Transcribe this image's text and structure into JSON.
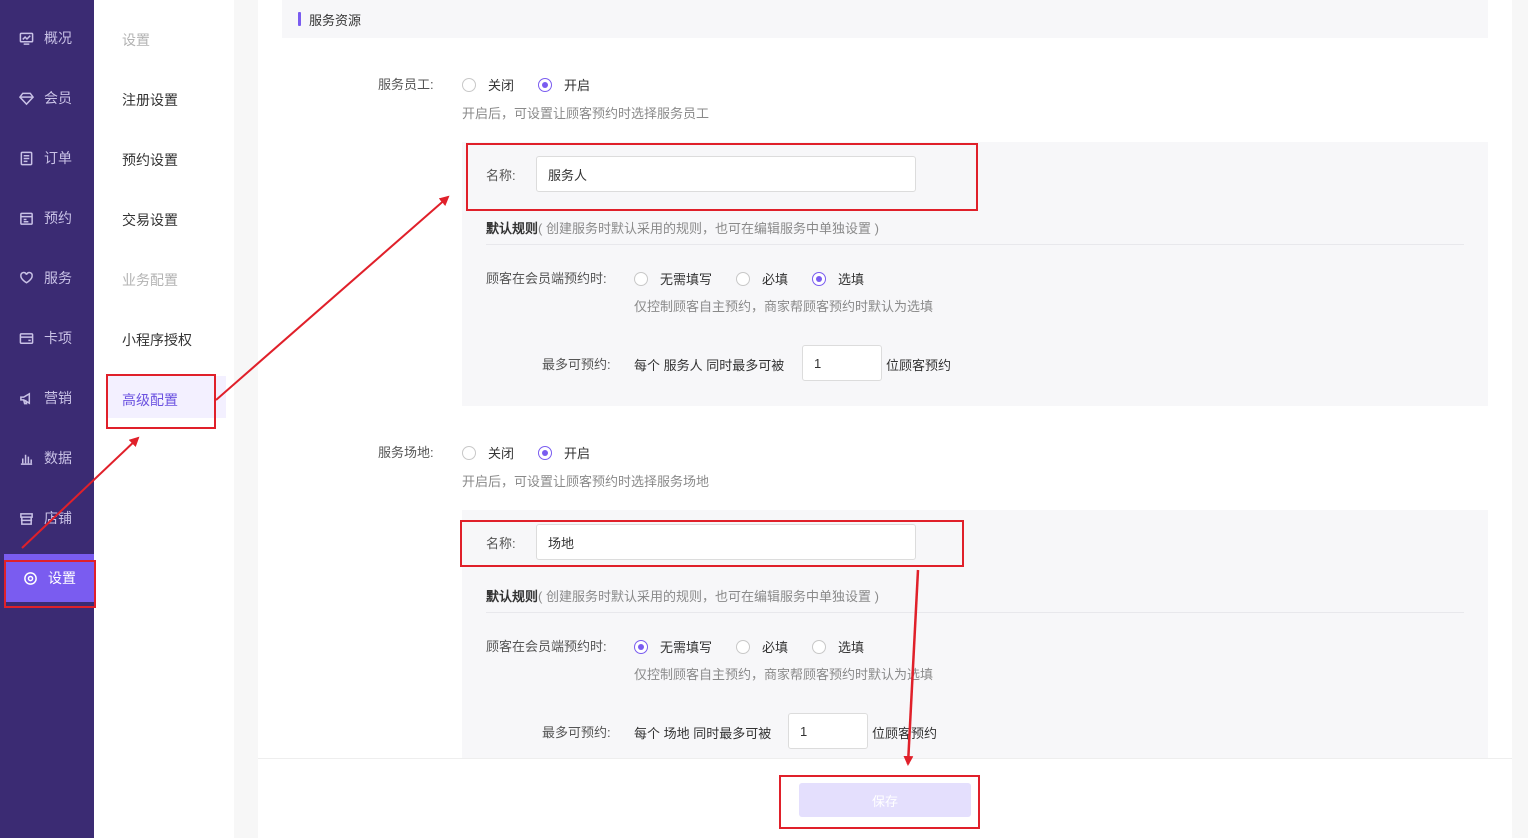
{
  "nav": {
    "items": [
      {
        "label": "概况",
        "icon": "monitor-icon"
      },
      {
        "label": "会员",
        "icon": "diamond-icon"
      },
      {
        "label": "订单",
        "icon": "list-icon"
      },
      {
        "label": "预约",
        "icon": "calendar-icon"
      },
      {
        "label": "服务",
        "icon": "heart-hand-icon"
      },
      {
        "label": "卡项",
        "icon": "card-icon"
      },
      {
        "label": "营销",
        "icon": "megaphone-icon"
      },
      {
        "label": "数据",
        "icon": "bar-chart-icon"
      },
      {
        "label": "店铺",
        "icon": "store-icon"
      },
      {
        "label": "设置",
        "icon": "gear-icon",
        "active": true
      }
    ]
  },
  "subnav": {
    "items": [
      {
        "label": "设置",
        "disabled": true
      },
      {
        "label": "注册设置"
      },
      {
        "label": "预约设置"
      },
      {
        "label": "交易设置"
      },
      {
        "label": "业务配置",
        "disabled": true
      },
      {
        "label": "小程序授权"
      },
      {
        "label": "高级配置",
        "active": true
      }
    ]
  },
  "section": {
    "title": "服务资源"
  },
  "staff": {
    "label": "服务员工:",
    "options": [
      "关闭",
      "开启"
    ],
    "selected": "开启",
    "hint": "开启后，可设置让顾客预约时选择服务员工",
    "name_label": "名称:",
    "name_value": "服务人",
    "rule_title": "默认规则",
    "rule_desc": "( 创建服务时默认采用的规则，也可在编辑服务中单独设置 )",
    "member_label": "顾客在会员端预约时:",
    "member_options": [
      "无需填写",
      "必填",
      "选填"
    ],
    "member_selected": "选填",
    "member_hint": "仅控制顾客自主预约，商家帮顾客预约时默认为选填",
    "max_label": "最多可预约:",
    "max_prefix": "每个 服务人 同时最多可被",
    "max_value": "1",
    "max_suffix": "位顾客预约"
  },
  "venue": {
    "label": "服务场地:",
    "options": [
      "关闭",
      "开启"
    ],
    "selected": "开启",
    "hint": "开启后，可设置让顾客预约时选择服务场地",
    "name_label": "名称:",
    "name_value": "场地",
    "rule_title": "默认规则",
    "rule_desc": "( 创建服务时默认采用的规则，也可在编辑服务中单独设置 )",
    "member_label": "顾客在会员端预约时:",
    "member_options": [
      "无需填写",
      "必填",
      "选填"
    ],
    "member_selected": "无需填写",
    "member_hint": "仅控制顾客自主预约，商家帮顾客预约时默认为选填",
    "max_label": "最多可预约:",
    "max_prefix": "每个 场地 同时最多可被",
    "max_value": "1",
    "max_suffix": "位顾客预约"
  },
  "footer": {
    "save_label": "保存"
  },
  "colors": {
    "sidebar": "#3b2b73",
    "accent": "#7a5cf0",
    "annotation": "#e0202a"
  }
}
